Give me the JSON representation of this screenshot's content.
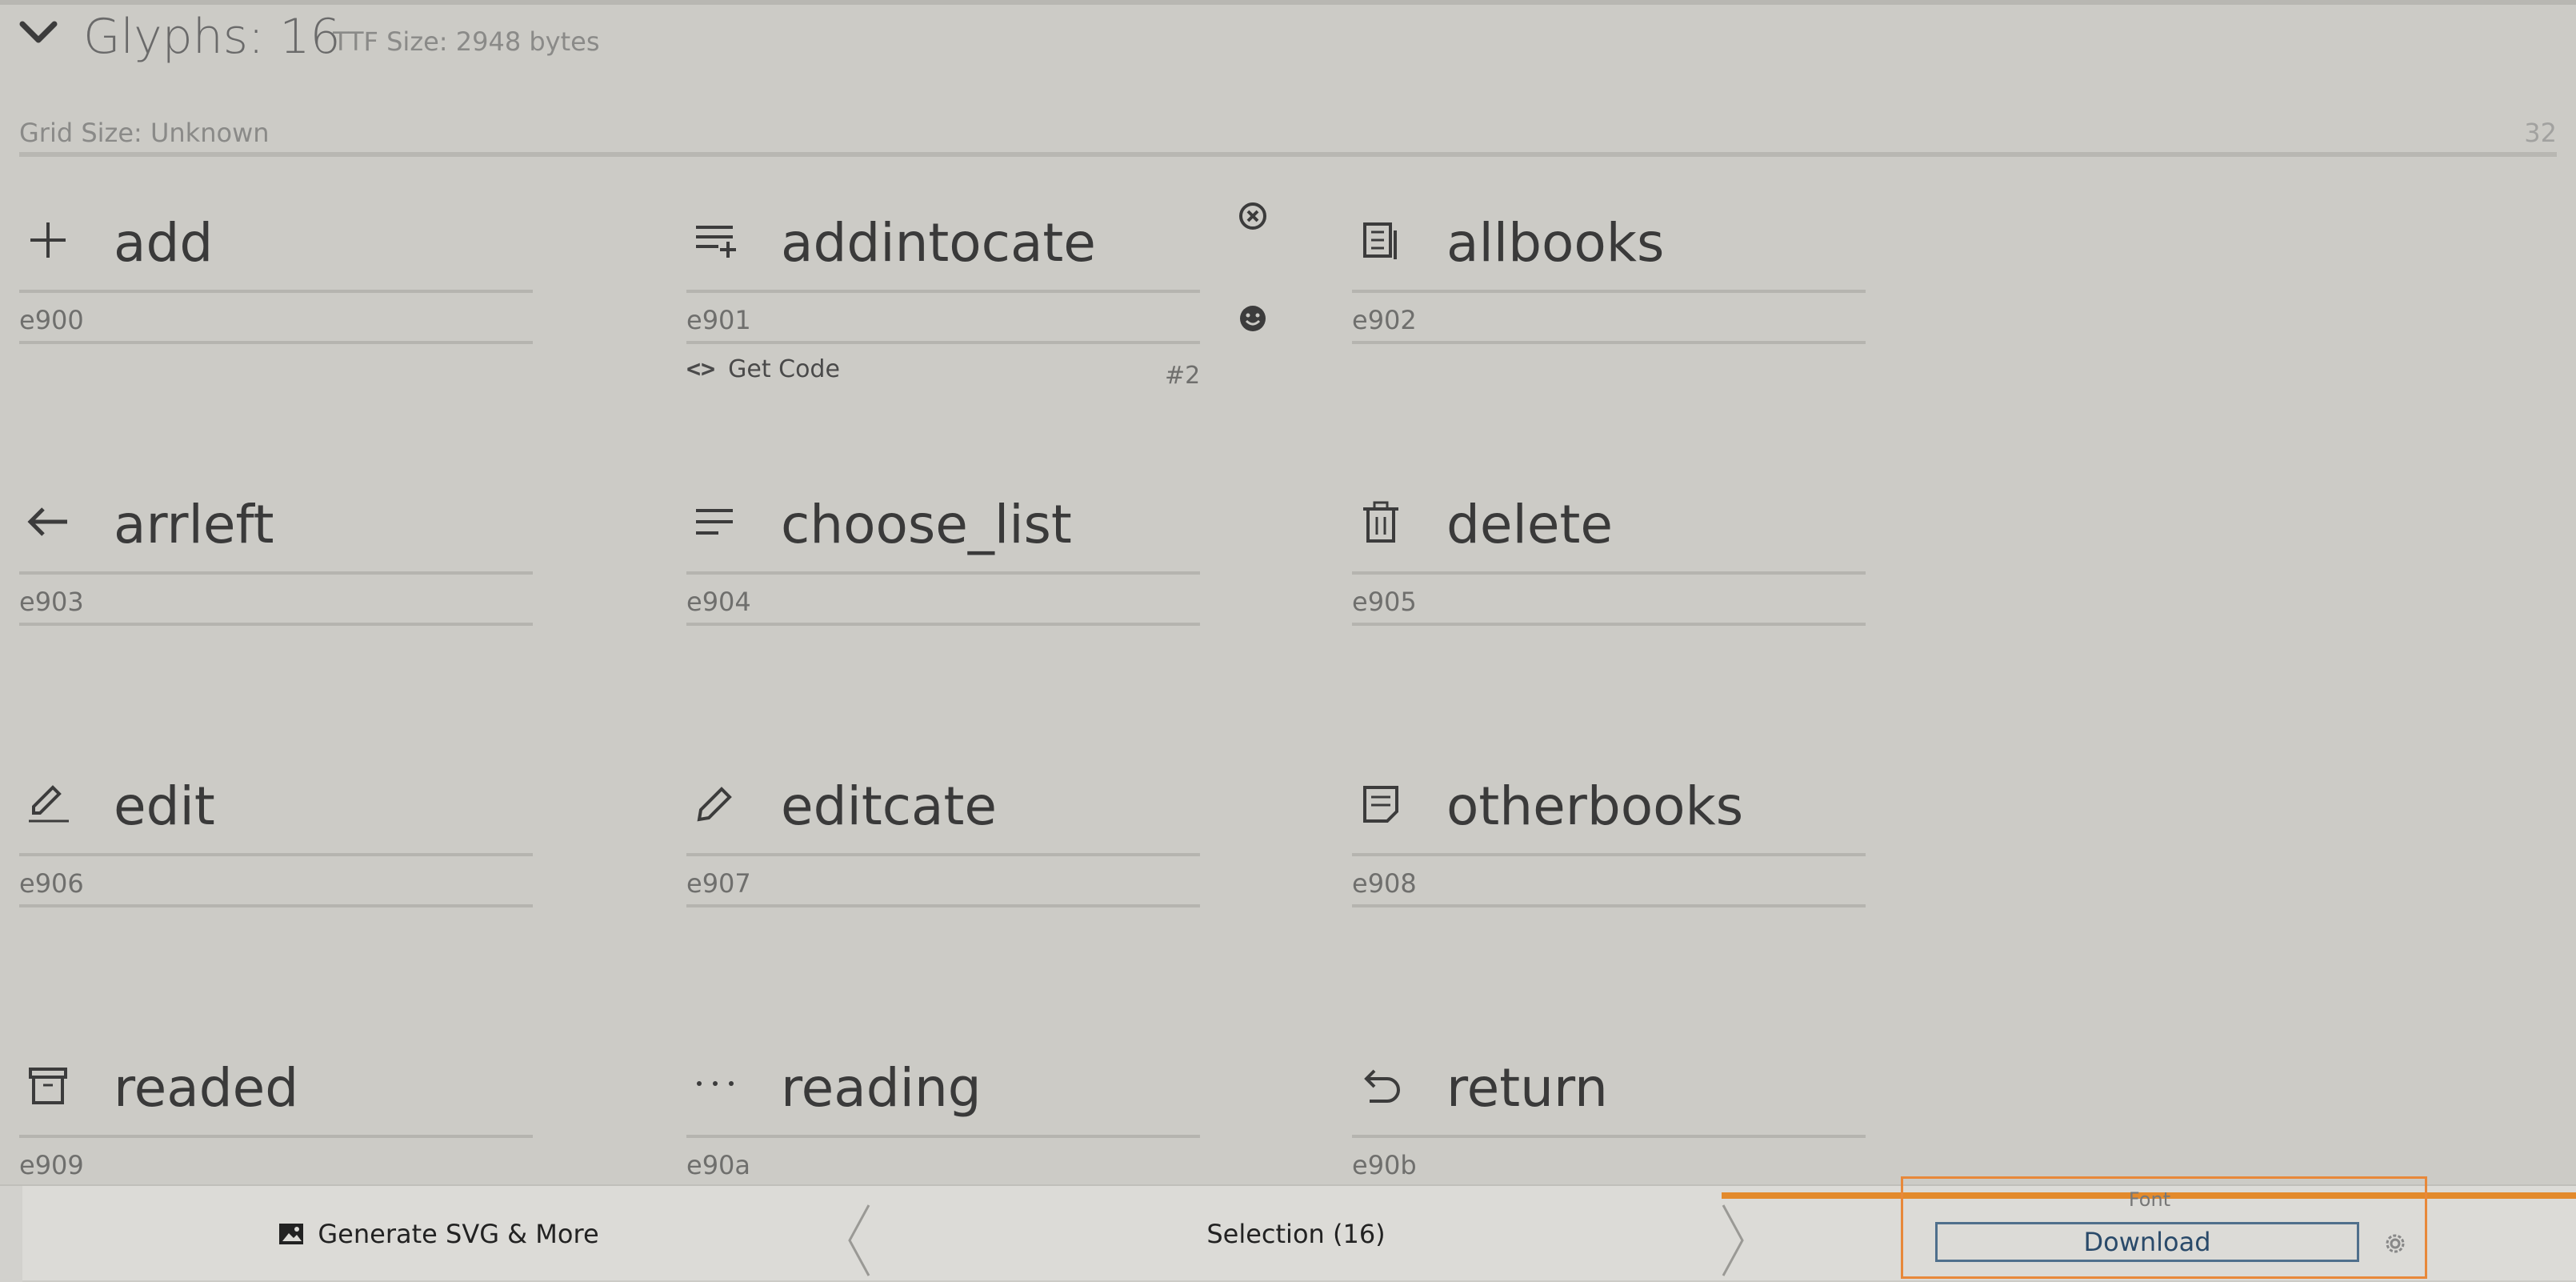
{
  "header": {
    "glyph_count": "Glyphs: 16",
    "ttf_size": "TTF Size: 2948 bytes",
    "grid_size": "Grid Size: Unknown",
    "grid_number": "32"
  },
  "glyphs": [
    {
      "name": "add",
      "code": "e900",
      "icon": "plus-icon"
    },
    {
      "name": "addintocate",
      "code": "e901",
      "icon": "list-add-icon"
    },
    {
      "name": "allbooks",
      "code": "e902",
      "icon": "books-icon"
    },
    {
      "name": "arrleft",
      "code": "e903",
      "icon": "arrow-left-icon"
    },
    {
      "name": "choose_list",
      "code": "e904",
      "icon": "list-icon"
    },
    {
      "name": "delete",
      "code": "e905",
      "icon": "trash-icon"
    },
    {
      "name": "edit",
      "code": "e906",
      "icon": "edit-icon"
    },
    {
      "name": "editcate",
      "code": "e907",
      "icon": "pencil-icon"
    },
    {
      "name": "otherbooks",
      "code": "e908",
      "icon": "note-icon"
    },
    {
      "name": "readed",
      "code": "e909",
      "icon": "archive-icon"
    },
    {
      "name": "reading",
      "code": "e90a",
      "icon": "ellipsis-icon"
    },
    {
      "name": "return",
      "code": "e90b",
      "icon": "undo-icon"
    }
  ],
  "selected_glyph": {
    "get_code": "Get Code",
    "index": "#2"
  },
  "bottombar": {
    "generate": "Generate SVG & More",
    "selection": "Selection (16)",
    "font_label": "Font",
    "download": "Download"
  },
  "colors": {
    "background": "#cccbc6",
    "accent_orange": "#e38a2c",
    "download_border": "#4f6f8c"
  }
}
